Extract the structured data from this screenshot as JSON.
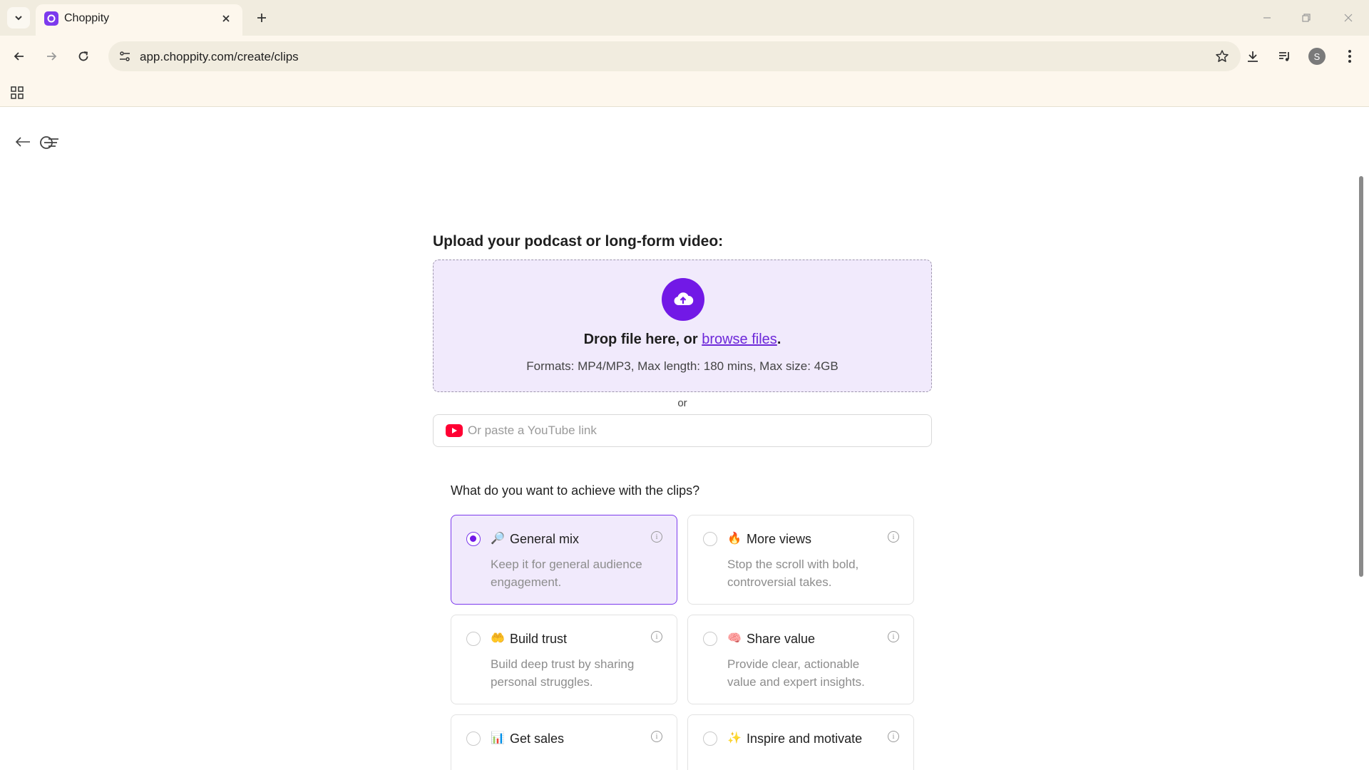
{
  "browser": {
    "tab_title": "Choppity",
    "url": "app.choppity.com/create/clips",
    "avatar_letter": "S"
  },
  "upload": {
    "heading": "Upload your podcast or long-form video:",
    "drop_prefix": "Drop file here, or ",
    "browse_label": "browse files",
    "drop_suffix": ".",
    "formats": "Formats: MP4/MP3, Max length: 180 mins, Max size: 4GB",
    "or_label": "or",
    "youtube_placeholder": "Or paste a YouTube link"
  },
  "goals": {
    "heading": "What do you want to achieve with the clips?",
    "selected": "General mix",
    "options": [
      {
        "emoji": "🔎",
        "title": "General mix",
        "desc": "Keep it for general audience engagement."
      },
      {
        "emoji": "🔥",
        "title": "More views",
        "desc": "Stop the scroll with bold, controversial takes."
      },
      {
        "emoji": "🤲",
        "title": "Build trust",
        "desc": "Build deep trust by sharing personal struggles."
      },
      {
        "emoji": "🧠",
        "title": "Share value",
        "desc": "Provide clear, actionable value and expert insights."
      },
      {
        "emoji": "📊",
        "title": "Get sales",
        "desc": ""
      },
      {
        "emoji": "✨",
        "title": "Inspire and motivate",
        "desc": ""
      }
    ]
  },
  "colors": {
    "accent": "#7219e6",
    "dropzone_bg": "#f1eafc",
    "youtube_red": "#ff0033"
  }
}
